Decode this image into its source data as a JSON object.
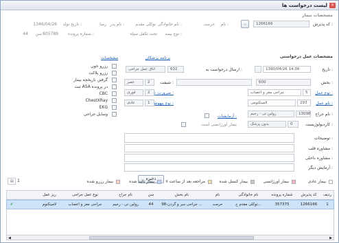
{
  "window": {
    "title": "لیست درخواست ها",
    "close_label": "×"
  },
  "patient_section": {
    "title": "مشخصات بیمار",
    "admission_code_label": "کد پذیرش :",
    "admission_code": "1266166",
    "name_label": "نام :",
    "name": "حرمت",
    "family_label": "نام خانوادگی :",
    "family": "توکلی مقدم",
    "father_label": "نام پدر :",
    "father": "رضا",
    "birth_label": "تاریخ تولد :",
    "birth": "1346/04/26",
    "insurance_label": "نوع بیمه :",
    "insurance": "تحت تکفل سپاه",
    "case_label": "شماره پرونده :",
    "case": "605789",
    "age_label": "سن :",
    "age": "44"
  },
  "request_section": {
    "title": "مشخصات عمل درخواستی",
    "date_label": "تاریخ :",
    "date": "1390/04/26 14:36",
    "send_label": "ارسال درخواست به :",
    "send_code": "632",
    "send_value": "اتاق عمل جراحی",
    "schedule_link": "برنامه پزشکان",
    "ward_label": "بخش :",
    "ward_code": "600",
    "shift_label": "شیفت :",
    "shift_code": "2",
    "shift_value": "عصر",
    "op_type_label": "نوع عمل :",
    "op_type_code": "5",
    "op_type_value": "جراحی مغز و اعصاب",
    "urgency_label": "ضرورت عمل :",
    "urgency_code": "2",
    "urgency_value": "فوری",
    "op_name_label": "نام عمل :",
    "op_name_code": "293",
    "op_name_value": "لامینکتومی",
    "anesthesia_label": "نوع بیهوشی :",
    "anesthesia_code": "1",
    "anesthesia_value": "عادی",
    "surgeon_label": "نام جراح :",
    "surgeon_code": "13098",
    "surgeon_value": "رولین تی - رحیم",
    "tests_link": "آزمایشات :",
    "cardiologist_label": "کاردیولوژیست :",
    "cardiologist_code": "0",
    "cardiologist_value": "بدون پزشک",
    "emergency_label": "بیمار اورژانسی است",
    "description_label": "توضیحات :",
    "cardio_consult_label": "مشاوره قلب :",
    "internal_consult_label": "مشاوره داخلی :",
    "other_tests_label": "آزمایش دیگر :",
    "save_button": "ذخیره"
  },
  "specs": {
    "title": "مشخصات",
    "items": [
      "رزرو خون",
      "رزرو پلاکت",
      "گرفتن تاریخچه بیمار",
      "ثبت ASA در پرونده",
      "CBC",
      "ChestXRay",
      "EKG",
      "وسایل جراحی"
    ]
  },
  "legend": [
    {
      "label": "بیمار عادی",
      "color": "#ffffff"
    },
    {
      "label": "بیمار اورژانسی",
      "color": "#f6b6c0"
    },
    {
      "label": "بیمار کنسل شده",
      "color": "#c8c8c8"
    },
    {
      "label": "مراجعه بعد از ساعت ۷",
      "color": "#f8e0a8"
    },
    {
      "label": "بیمار تائید شده",
      "color": "#bcd8f4"
    },
    {
      "label": "بیمار رزرو شده",
      "color": "#f9d2b8"
    }
  ],
  "page_number": "1",
  "grid": {
    "columns": [
      "ردیف",
      "کد پذیرش",
      "شماره پرونده",
      "نام خانوادگی",
      "نام",
      "نام بخش",
      "سن",
      "نام جراح",
      "نوع عمل جراحی",
      "ریز عمل"
    ],
    "rows": [
      [
        "1",
        "1266166",
        "357375",
        "توکلی مقدم ح...",
        "حرمت",
        "98-جراحی سر و گردن ...",
        "44",
        "رولین تی - رحیم",
        "جراحی مغز و اعصاب",
        "لامینکتوم"
      ]
    ]
  }
}
